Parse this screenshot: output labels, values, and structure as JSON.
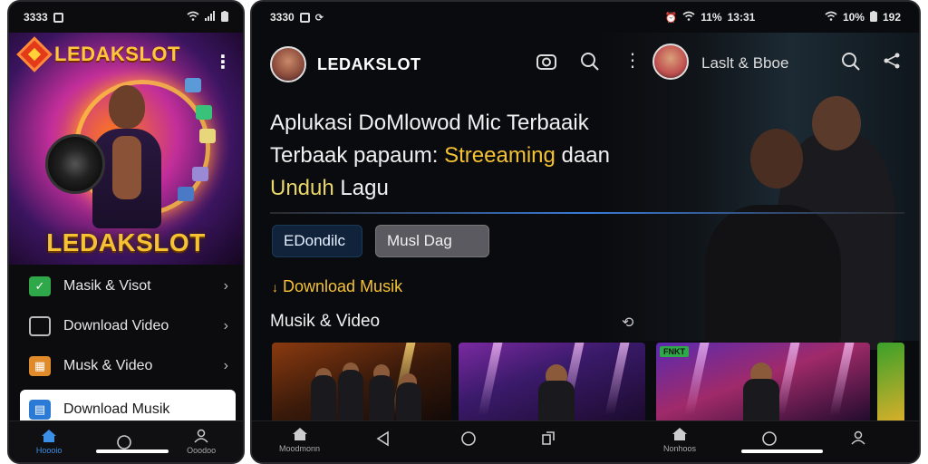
{
  "left_phone": {
    "status": {
      "time": "3333",
      "battery": ""
    },
    "brand": "LEDAKSLOT",
    "big_brand": "LEDAKSLOT",
    "menu": [
      {
        "label": "Masik & Visot",
        "icon": "check-shield-icon"
      },
      {
        "label": "Download Video",
        "icon": "video-frame-icon"
      },
      {
        "label": "Musk & Video",
        "icon": "music-folder-icon"
      },
      {
        "label": "Download Musik",
        "icon": "browser-window-icon"
      }
    ],
    "nav": {
      "home": "Hoooio",
      "profile": "Ooodoo"
    }
  },
  "right_phone": {
    "status": {
      "time": "3330",
      "mid": "13:31",
      "right": "10%",
      "right_time": "192",
      "batt_pct": "11%"
    },
    "app_title": "LEDAKSLOT",
    "profile_name": "Laslt & Bboe",
    "headline": {
      "line1": "Aplukasi DoMlowod Mic Terbaaik",
      "line2_a": "Terbaak papaum: ",
      "line2_b": "Streeaming",
      "line2_c": " daan",
      "line3_a": "Unduh",
      "line3_b": " Lagu"
    },
    "chips": [
      "EDondilc",
      "Musl Dag"
    ],
    "download_link": "Download Musik",
    "section_title": "Musik & Video",
    "cards": [
      {
        "badge": ""
      },
      {
        "badge": ""
      },
      {
        "badge": "FNKT"
      },
      {
        "badge": ""
      }
    ],
    "nav": {
      "home": "Moodmonn",
      "home2": "Nonhoos"
    }
  },
  "colors": {
    "accent_yellow": "#f5c233",
    "accent_blue": "#3b8fe6",
    "bg": "#0a0b0e"
  }
}
